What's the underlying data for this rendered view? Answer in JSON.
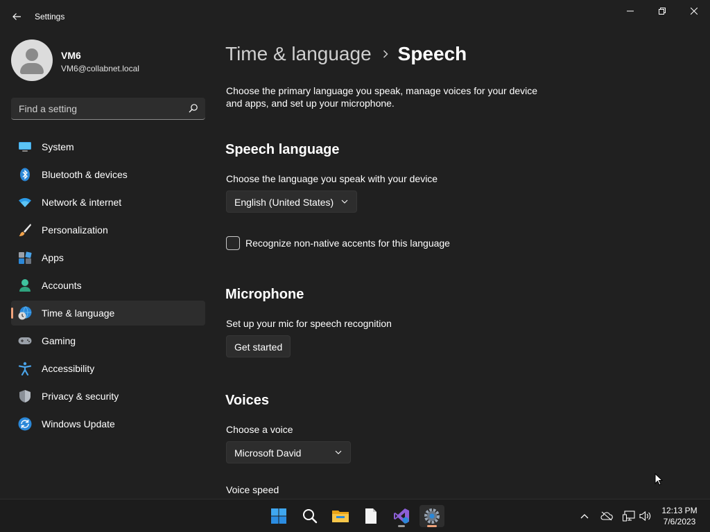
{
  "window": {
    "title": "Settings"
  },
  "profile": {
    "name": "VM6",
    "email": "VM6@collabnet.local"
  },
  "search": {
    "placeholder": "Find a setting"
  },
  "sidebar": {
    "items": [
      {
        "label": "System",
        "icon": "system-icon",
        "active": false
      },
      {
        "label": "Bluetooth & devices",
        "icon": "bluetooth-icon",
        "active": false
      },
      {
        "label": "Network & internet",
        "icon": "wifi-icon",
        "active": false
      },
      {
        "label": "Personalization",
        "icon": "brush-icon",
        "active": false
      },
      {
        "label": "Apps",
        "icon": "apps-icon",
        "active": false
      },
      {
        "label": "Accounts",
        "icon": "accounts-icon",
        "active": false
      },
      {
        "label": "Time & language",
        "icon": "time-language-icon",
        "active": true
      },
      {
        "label": "Gaming",
        "icon": "gamepad-icon",
        "active": false
      },
      {
        "label": "Accessibility",
        "icon": "accessibility-icon",
        "active": false
      },
      {
        "label": "Privacy & security",
        "icon": "shield-icon",
        "active": false
      },
      {
        "label": "Windows Update",
        "icon": "update-icon",
        "active": false
      }
    ]
  },
  "main": {
    "breadcrumb_parent": "Time & language",
    "breadcrumb_current": "Speech",
    "intro": "Choose the primary language you speak, manage voices for your device and apps, and set up your microphone.",
    "speech_language": {
      "heading": "Speech language",
      "description": "Choose the language you speak with your device",
      "selected": "English (United States)",
      "checkbox_label": "Recognize non-native accents for this language",
      "checkbox_checked": false
    },
    "microphone": {
      "heading": "Microphone",
      "description": "Set up your mic for speech recognition",
      "button": "Get started"
    },
    "voices": {
      "heading": "Voices",
      "description": "Choose a voice",
      "selected": "Microsoft David",
      "speed_label": "Voice speed"
    }
  },
  "taskbar": {
    "apps": [
      "start-icon",
      "search-icon",
      "file-explorer-icon",
      "notepad-icon",
      "visual-studio-icon",
      "settings-icon"
    ],
    "tray_icons": [
      "chevron-up-icon",
      "cloud-offline-icon",
      "network-icon",
      "volume-icon"
    ],
    "time": "12:13 PM",
    "date": "7/6/2023"
  },
  "colors": {
    "background": "#202020",
    "accent": "#f0a37b",
    "surface": "#2d2d2d"
  }
}
